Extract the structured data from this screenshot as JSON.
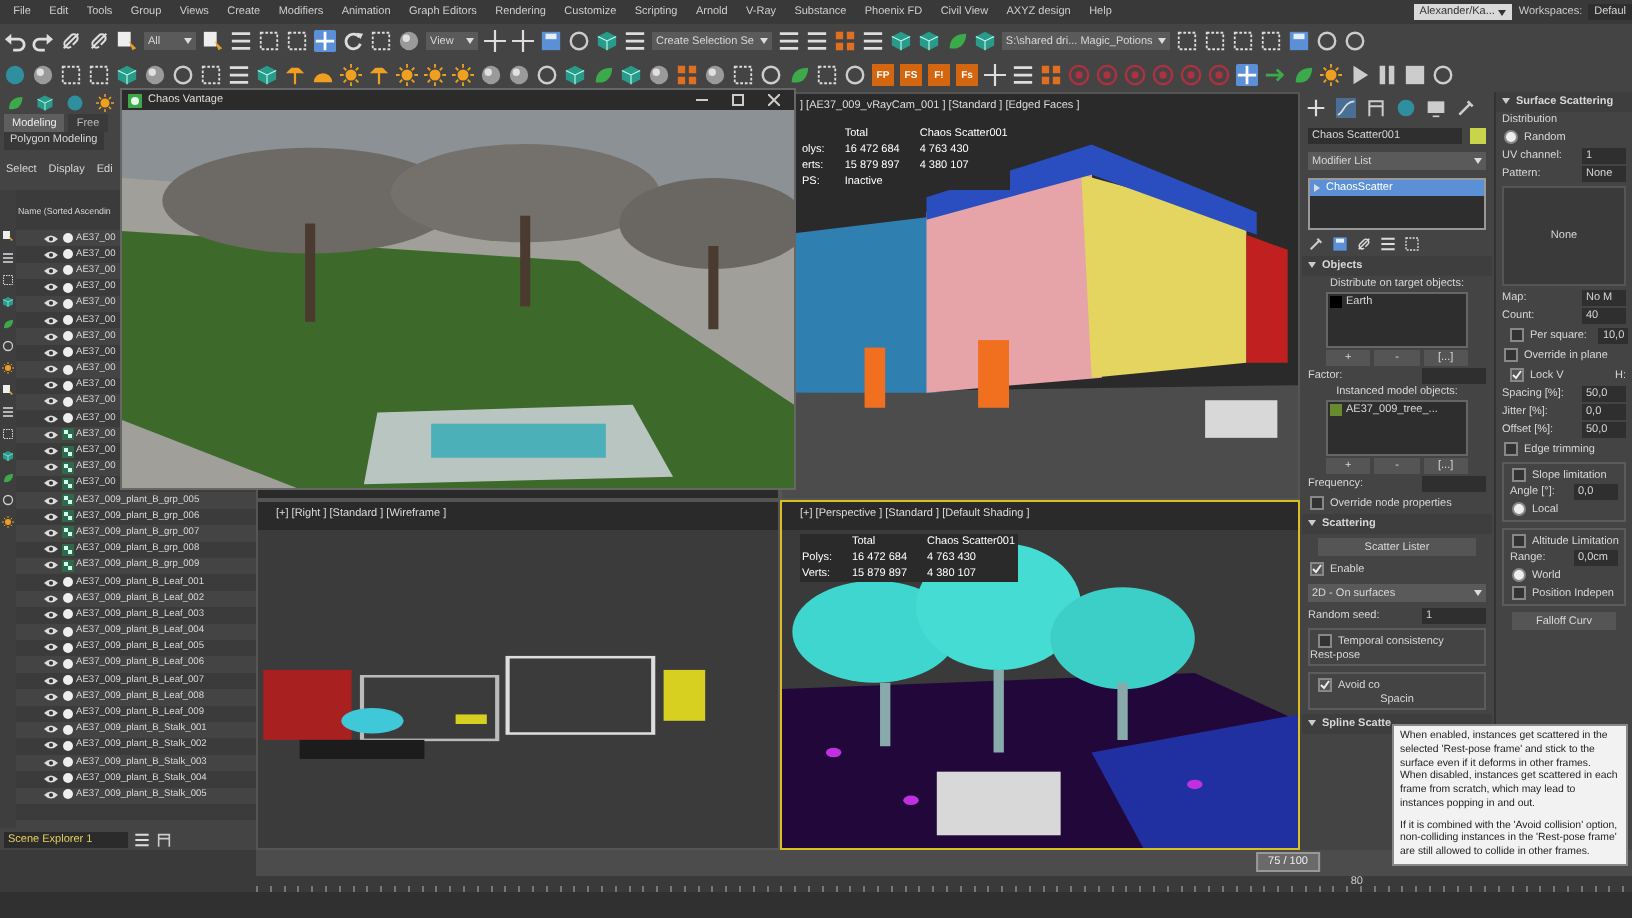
{
  "menu_bar": {
    "items": [
      "File",
      "Edit",
      "Tools",
      "Group",
      "Views",
      "Create",
      "Modifiers",
      "Animation",
      "Graph Editors",
      "Rendering",
      "Customize",
      "Scripting",
      "Arnold",
      "V-Ray",
      "Substance",
      "Phoenix FD",
      "Civil View",
      "AXYZ design",
      "Help"
    ],
    "user": "Alexander/Ka...",
    "workspaces_label": "Workspaces:",
    "workspace": "Defaul"
  },
  "main_toolbar": {
    "selection_filter": "All",
    "coordinate_system": "View",
    "named_selection": "Create Selection Se",
    "project_folder": "S:\\shared dri... Magic_Potions"
  },
  "phoenix_buttons": [
    "FP",
    "FS",
    "F!",
    "Fs"
  ],
  "ribbon": {
    "tabs": [
      {
        "label": "Modeling",
        "selected": true
      },
      {
        "label": "Free",
        "selected": false
      }
    ],
    "panel": "Polygon Modeling"
  },
  "scene_explorer": {
    "menus": [
      "Select",
      "Display",
      "Edi"
    ],
    "column": "Name (Sorted Ascendin",
    "title": "Scene Explorer 1",
    "rows": [
      {
        "name": "AE37_00",
        "kind": "object"
      },
      {
        "name": "AE37_00",
        "kind": "object"
      },
      {
        "name": "AE37_00",
        "kind": "object"
      },
      {
        "name": "AE37_00",
        "kind": "object"
      },
      {
        "name": "AE37_00",
        "kind": "object"
      },
      {
        "name": "AE37_00",
        "kind": "object"
      },
      {
        "name": "AE37_00",
        "kind": "object"
      },
      {
        "name": "AE37_00",
        "kind": "object"
      },
      {
        "name": "AE37_00",
        "kind": "object"
      },
      {
        "name": "AE37_00",
        "kind": "object"
      },
      {
        "name": "AE37_00",
        "kind": "object"
      },
      {
        "name": "AE37_00",
        "kind": "object"
      },
      {
        "name": "AE37_00",
        "kind": "group"
      },
      {
        "name": "AE37_00",
        "kind": "group"
      },
      {
        "name": "AE37_00",
        "kind": "group"
      },
      {
        "name": "AE37_00",
        "kind": "group"
      },
      {
        "name": "AE37_009_plant_B_grp_005",
        "kind": "group"
      },
      {
        "name": "AE37_009_plant_B_grp_006",
        "kind": "group"
      },
      {
        "name": "AE37_009_plant_B_grp_007",
        "kind": "group"
      },
      {
        "name": "AE37_009_plant_B_grp_008",
        "kind": "group"
      },
      {
        "name": "AE37_009_plant_B_grp_009",
        "kind": "group"
      },
      {
        "name": "AE37_009_plant_B_Leaf_001",
        "kind": "object"
      },
      {
        "name": "AE37_009_plant_B_Leaf_002",
        "kind": "object"
      },
      {
        "name": "AE37_009_plant_B_Leaf_003",
        "kind": "object"
      },
      {
        "name": "AE37_009_plant_B_Leaf_004",
        "kind": "object"
      },
      {
        "name": "AE37_009_plant_B_Leaf_005",
        "kind": "object"
      },
      {
        "name": "AE37_009_plant_B_Leaf_006",
        "kind": "object"
      },
      {
        "name": "AE37_009_plant_B_Leaf_007",
        "kind": "object"
      },
      {
        "name": "AE37_009_plant_B_Leaf_008",
        "kind": "object"
      },
      {
        "name": "AE37_009_plant_B_Leaf_009",
        "kind": "object"
      },
      {
        "name": "AE37_009_plant_B_Stalk_001",
        "kind": "object"
      },
      {
        "name": "AE37_009_plant_B_Stalk_002",
        "kind": "object"
      },
      {
        "name": "AE37_009_plant_B_Stalk_003",
        "kind": "object"
      },
      {
        "name": "AE37_009_plant_B_Stalk_004",
        "kind": "object"
      },
      {
        "name": "AE37_009_plant_B_Stalk_005",
        "kind": "object"
      }
    ]
  },
  "vantage_window": {
    "title": "Chaos Vantage"
  },
  "viewports": [
    {
      "kind": "hidden"
    },
    {
      "kind": "camera",
      "selected": false,
      "label": "] [AE37_009_vRayCam_001 ] [Standard ] [Edged Faces ]",
      "stats": {
        "headers": [
          "Total",
          "Chaos Scatter001"
        ],
        "rows": [
          {
            "label": "olys:",
            "values": [
              "16 472 684",
              "4 763 430"
            ]
          },
          {
            "label": "erts:",
            "values": [
              "15 879 897",
              "4 380 107"
            ]
          },
          {
            "label": "PS:",
            "values": [
              "Inactive"
            ]
          }
        ]
      }
    },
    {
      "kind": "wireframe",
      "selected": false,
      "label": "[+] [Right ] [Standard ] [Wireframe ]"
    },
    {
      "kind": "perspective",
      "selected": true,
      "label": "[+] [Perspective ] [Standard ] [Default Shading ]",
      "stats": {
        "headers": [
          "Total",
          "Chaos Scatter001"
        ],
        "rows": [
          {
            "label": "Polys:",
            "values": [
              "16 472 684",
              "4 763 430"
            ]
          },
          {
            "label": "Verts:",
            "values": [
              "15 879 897",
              "4 380 107"
            ]
          }
        ]
      }
    }
  ],
  "command_panel": {
    "object_name": "Chaos Scatter001",
    "modifier_list": "Modifier List",
    "stack": [
      {
        "label": "ChaosScatter",
        "selected": true
      }
    ],
    "objects": {
      "title": "Objects",
      "targets_label": "Distribute on target objects:",
      "targets": [
        {
          "name": "Earth",
          "color": "#000000"
        }
      ],
      "target_buttons": [
        "+",
        "-",
        "[...]"
      ],
      "factor_label": "Factor:",
      "instanced_label": "Instanced model objects:",
      "instanced": [
        {
          "name": "AE37_009_tree_...",
          "color": "#6a8a30"
        }
      ],
      "instanced_buttons": [
        "+",
        "-",
        "[...]"
      ],
      "frequency_label": "Frequency:",
      "override": {
        "label": "Override node properties",
        "checked": false
      }
    },
    "scattering": {
      "title": "Scattering",
      "lister": "Scatter Lister",
      "enable": {
        "label": "Enable",
        "checked": true
      },
      "mode": "2D - On surfaces",
      "seed_label": "Random seed:",
      "seed": "1",
      "temporal": {
        "label": "Temporal consistency",
        "checked": false
      },
      "rest_pose": "Rest-pose",
      "avoid": {
        "label": "Avoid co",
        "checked": true
      },
      "spacing": "Spacin"
    },
    "spline_title": "Spline Scatte"
  },
  "surface_scattering": {
    "title": "Surface Scattering",
    "distribution_label": "Distribution",
    "distribution": [
      {
        "label": "Random",
        "selected": true
      }
    ],
    "uv_label": "UV channel:",
    "uv": "1",
    "pattern_label": "Pattern:",
    "pattern": "None",
    "preview": "None",
    "map_label": "Map:",
    "map": "No M",
    "count_label": "Count:",
    "count": "40",
    "per_square": {
      "label": "Per square:",
      "value": "10,0",
      "checked": false
    },
    "override_plane": {
      "label": "Override in plane",
      "checked": false
    },
    "lock": {
      "label": "Lock V",
      "checked": true
    },
    "h_label": "H:",
    "params": [
      {
        "label": "Spacing [%]:",
        "value": "50,0"
      },
      {
        "label": "Jitter [%]:",
        "value": "0,0"
      },
      {
        "label": "Offset [%]:",
        "value": "50,0"
      }
    ],
    "edge": {
      "label": "Edge trimming",
      "checked": false
    },
    "slope": {
      "label": "Slope limitation",
      "checked": false
    },
    "angle_label": "Angle [°]:",
    "angle": "0,0",
    "slope_space": {
      "label": "Local",
      "selected": true
    },
    "altitude": {
      "label": "Altitude Limitation",
      "checked": false
    },
    "range_label": "Range:",
    "range": "0,0cm",
    "altitude_space": {
      "label": "World",
      "selected": true
    },
    "position_independent": {
      "label": "Position Indepen",
      "checked": false
    },
    "falloff": "Falloff Curv"
  },
  "tooltip": {
    "paragraphs": [
      "When enabled, instances get scattered in the selected 'Rest-pose frame' and stick to the surface even if it deforms in other frames. When disabled, instances get scattered in each frame from scratch, which may lead to instances popping in and out.",
      "If it is combined with the 'Avoid collision' option, non-colliding instances in the 'Rest-pose frame' are still allowed to collide in other frames."
    ]
  },
  "timeline": {
    "frame": "75 / 100",
    "level": 0.75,
    "tick_labels": [
      "80"
    ]
  }
}
